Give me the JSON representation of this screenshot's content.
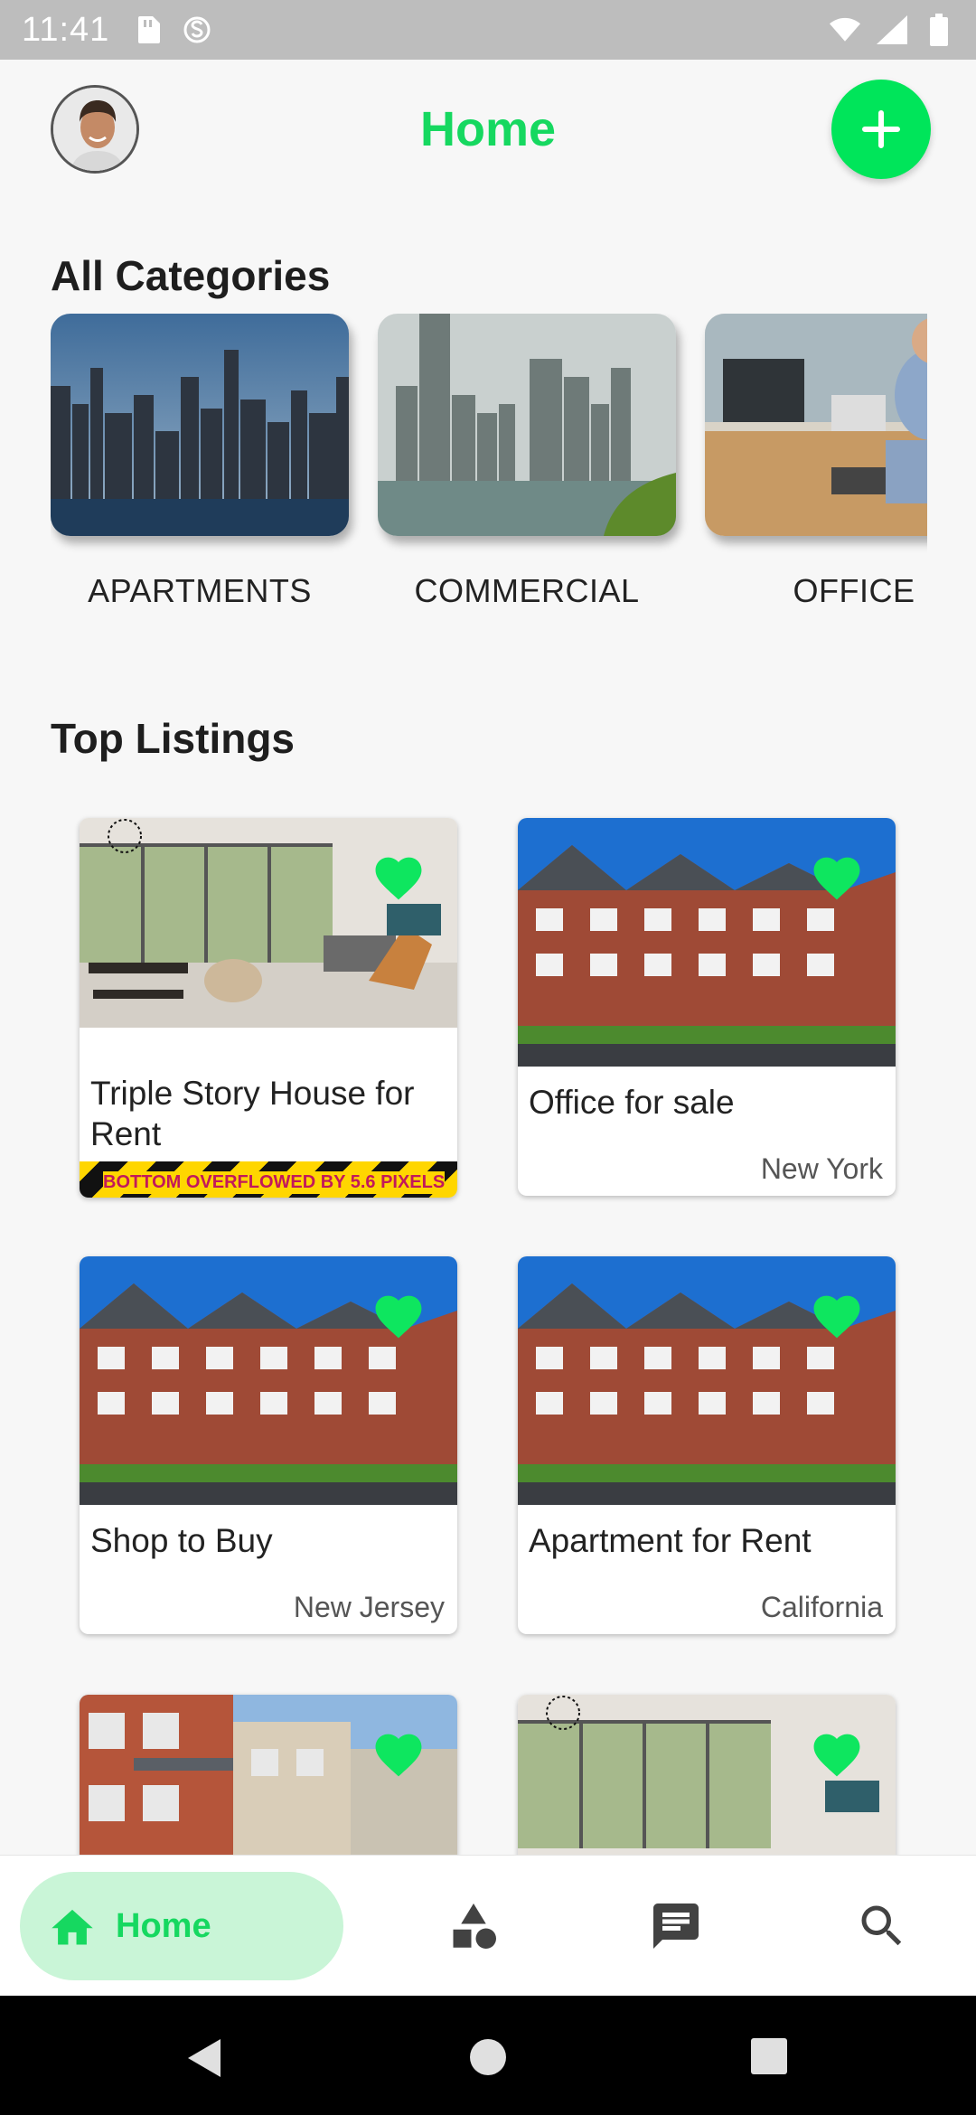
{
  "status_bar": {
    "time": "11:41"
  },
  "header": {
    "title": "Home"
  },
  "categories": {
    "title": "All Categories",
    "items": [
      {
        "label": "APARTMENTS"
      },
      {
        "label": "COMMERCIAL"
      },
      {
        "label": "OFFICE"
      }
    ]
  },
  "listings": {
    "title": "Top Listings",
    "items": [
      {
        "title": "Triple Story House for Rent",
        "location": "",
        "overflow_text": "BOTTOM OVERFLOWED BY 5.6 PIXELS"
      },
      {
        "title": "Office for sale",
        "location": "New York"
      },
      {
        "title": "Shop to Buy",
        "location": "New Jersey"
      },
      {
        "title": "Apartment for Rent",
        "location": "California"
      }
    ]
  },
  "bottom_nav": {
    "home_label": "Home"
  },
  "colors": {
    "accent": "#16d860",
    "fab": "#00e55a",
    "heart": "#0ee65f"
  }
}
